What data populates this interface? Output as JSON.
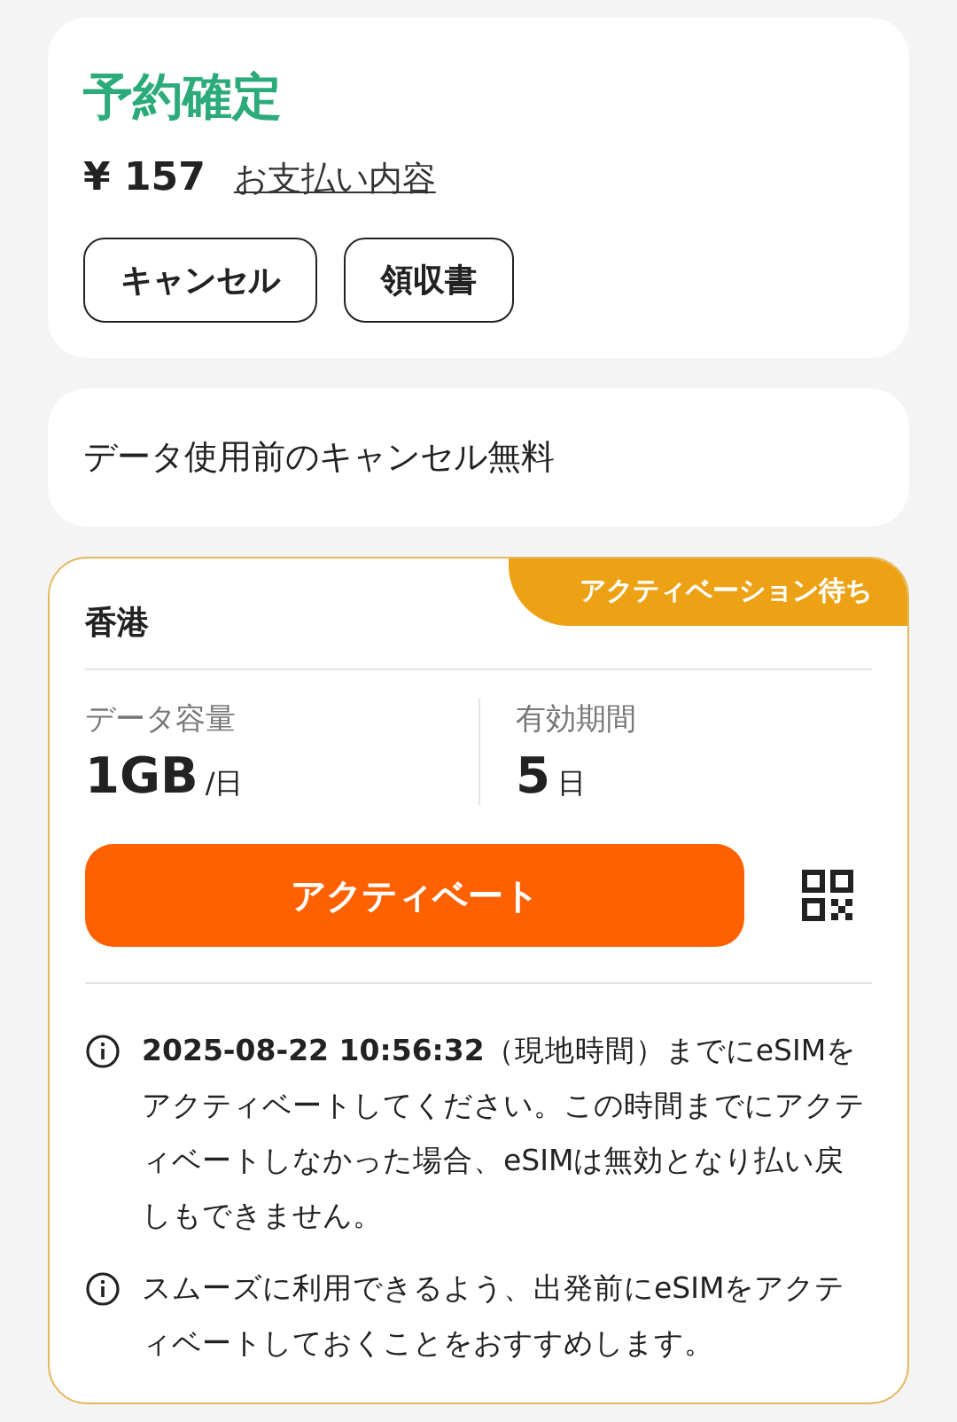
{
  "booking": {
    "status": "予約確定",
    "price": "¥ 157",
    "payment_link": "お支払い内容",
    "buttons": [
      "キャンセル",
      "領収書"
    ]
  },
  "cancel_notice": "データ使用前のキャンセル無料",
  "plan": {
    "region": "香港",
    "badge": "アクティベーション待ち",
    "stats": [
      {
        "label": "データ容量",
        "value": "1GB",
        "unit": "/日"
      },
      {
        "label": "有効期間",
        "value": "5",
        "unit": "日"
      }
    ],
    "activate_button": "アクティベート",
    "notes": [
      "**2025-08-22 10:56:32**（現地時間）までにeSIMをアクティベートしてください。この時間までにアクティベートしなかった場合、eSIMは無効となり払い戻しもできません。",
      "スムーズに利用できるよう、出発前にeSIMをアクティベートしておくことをおすすめします。"
    ]
  }
}
